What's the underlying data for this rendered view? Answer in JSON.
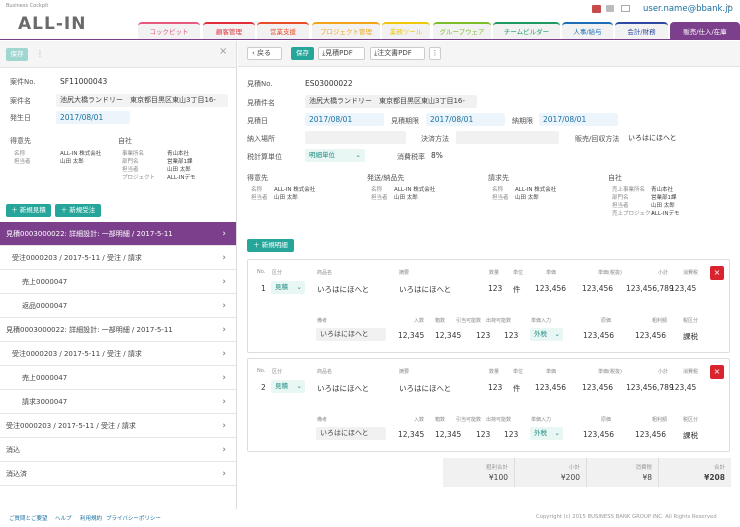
{
  "header": {
    "cockpit": "Business Cockpit",
    "logo": "ALL-IN",
    "user": "user.name@bbank.jp",
    "tabs": [
      {
        "label": "コックピット",
        "color": "#e85a7d"
      },
      {
        "label": "顧客管理",
        "color": "#e02f3a"
      },
      {
        "label": "営業支援",
        "color": "#e94c28"
      },
      {
        "label": "プロジェクト管理",
        "color": "#f2a51a"
      },
      {
        "label": "業務ツール",
        "color": "#eec70a"
      },
      {
        "label": "グループウェア",
        "color": "#7dbd2b"
      },
      {
        "label": "チームビルダー",
        "color": "#1f9a63"
      },
      {
        "label": "人事/給与",
        "color": "#1d6fb5"
      },
      {
        "label": "会計/財務",
        "color": "#2d4aa3"
      },
      {
        "label": "販売/仕入/在庫",
        "color": "#7b3f8c"
      }
    ]
  },
  "left": {
    "save": "保存",
    "menu": "⋮",
    "close": "×",
    "fields": [
      {
        "label": "案件No.",
        "value": "SF11000043"
      },
      {
        "label": "案件名",
        "value": "池尻大橋ランドリー　東京都目黒区東山3丁目16-"
      },
      {
        "label": "発生日",
        "value": "2017/08/01"
      }
    ],
    "tokui_title": "得意先",
    "tokui": [
      {
        "k": "名称",
        "v": "ALL-IN 株式会社"
      },
      {
        "k": "担当者",
        "v": "山田 太郎"
      }
    ],
    "jisha_title": "自社",
    "jisha": [
      {
        "k": "事業所名",
        "v": "青山本社"
      },
      {
        "k": "部門名",
        "v": "営業部1課"
      },
      {
        "k": "担当者",
        "v": "山田 太郎"
      },
      {
        "k": "プロジェクト",
        "v": "ALL-INデモ"
      }
    ],
    "new_estimate": "＋ 新規見積",
    "new_order": "＋ 新規受注",
    "list": [
      {
        "text": "見積0003000022: 詳細設計: 一部明細 / 2017-5-11",
        "level": 0,
        "active": true
      },
      {
        "text": "受注0000203 / 2017-5-11 / 受注 / 請求",
        "level": 1
      },
      {
        "text": "売上0000047",
        "level": 2
      },
      {
        "text": "返品0000047",
        "level": 2
      },
      {
        "text": "見積0003000022: 詳細設計: 一部明細 / 2017-5-11",
        "level": 0
      },
      {
        "text": "受注0000203 / 2017-5-11 / 受注 / 請求",
        "level": 1
      },
      {
        "text": "売上0000047",
        "level": 2
      },
      {
        "text": "請求3000047",
        "level": 2
      },
      {
        "text": "受注0000203 / 2017-5-11 / 受注 / 請求",
        "level": 0
      },
      {
        "text": "消込",
        "level": 0
      },
      {
        "text": "消込済",
        "level": 0
      }
    ]
  },
  "toolbar": {
    "back": "戻る",
    "save": "保存",
    "estimate_pdf": "見積PDF",
    "order_pdf": "注文書PDF",
    "menu": "⋮"
  },
  "form": {
    "estimate_no_label": "見積No.",
    "estimate_no": "ES03000022",
    "estimate_name_label": "見積件名",
    "estimate_name": "池尻大橋ランドリー　東京都目黒区東山3丁目16-",
    "estimate_date_label": "見積日",
    "estimate_date": "2017/08/01",
    "valid_label": "見積期限",
    "valid_date": "2017/08/01",
    "delivery_label": "納期限",
    "delivery_date": "2017/08/01",
    "place_label": "納入場所",
    "payment_label": "決済方法",
    "sales_label": "販売/回収方法",
    "sales_value": "いろはにほへと",
    "tax_unit_label": "税計算単位",
    "tax_unit": "明細単位",
    "tax_rate_label": "消費税率",
    "tax_rate": "8%"
  },
  "parties": [
    {
      "title": "得意先",
      "rows": [
        {
          "k": "名称",
          "v": "ALL-IN 株式会社"
        },
        {
          "k": "担当者",
          "v": "山田 太郎"
        }
      ]
    },
    {
      "title": "発送/納品先",
      "rows": [
        {
          "k": "名称",
          "v": "ALL-IN 株式会社"
        },
        {
          "k": "担当者",
          "v": "山田 太郎"
        }
      ]
    },
    {
      "title": "請求先",
      "rows": [
        {
          "k": "名称",
          "v": "ALL-IN 株式会社"
        },
        {
          "k": "担当者",
          "v": "山田 太郎"
        }
      ]
    },
    {
      "title": "自社",
      "rows": [
        {
          "k": "売上事業所名",
          "v": "青山本社"
        },
        {
          "k": "部門名",
          "v": "営業部1課"
        },
        {
          "k": "担当者",
          "v": "山田 太郎"
        },
        {
          "k": "売上プロジェクト",
          "v": "ALL-INデモ"
        }
      ]
    }
  ],
  "new_detail": "＋ 新規明細",
  "detail_headers": {
    "no": "No.",
    "kubun": "区分",
    "name": "商品名",
    "summary": "摘要",
    "qty": "数量",
    "unit": "単位",
    "price": "単価",
    "price_tax": "単価(税抜)",
    "subtotal": "小計",
    "tax": "消費税"
  },
  "detail_headers2": {
    "note": "備考",
    "in_qty": "入数",
    "boxes": "箱数",
    "deducted": "引当可能数",
    "shipped": "出荷可能数",
    "tax_input": "単価入力",
    "cost": "原価",
    "gross": "粗利額",
    "tax_type": "税区分"
  },
  "details": [
    {
      "no": "1",
      "kubun": "見積",
      "name": "いろはにほへと",
      "summary": "いろはにほへと",
      "qty": "123",
      "unit": "件",
      "price": "123,456",
      "price_tax": "123,456",
      "subtotal": "123,456,789",
      "tax": "123,45",
      "note": "いろはにほへと",
      "in_qty": "12,345",
      "boxes": "12,345",
      "deducted": "123",
      "shipped": "123",
      "tax_input": "外税",
      "cost": "123,456",
      "gross": "123,456",
      "tax_type": "課税"
    },
    {
      "no": "2",
      "kubun": "見積",
      "name": "いろはにほへと",
      "summary": "いろはにほへと",
      "qty": "123",
      "unit": "件",
      "price": "123,456",
      "price_tax": "123,456",
      "subtotal": "123,456,789",
      "tax": "123,45",
      "note": "いろはにほへと",
      "in_qty": "12,345",
      "boxes": "12,345",
      "deducted": "123",
      "shipped": "123",
      "tax_input": "外税",
      "cost": "123,456",
      "gross": "123,456",
      "tax_type": "課税"
    }
  ],
  "totals": [
    {
      "label": "粗利合計",
      "value": "¥100"
    },
    {
      "label": "小計",
      "value": "¥200"
    },
    {
      "label": "消費税",
      "value": "¥8"
    },
    {
      "label": "合計",
      "value": "¥208"
    }
  ],
  "footer": {
    "links": [
      "ご質問とご要望",
      "ヘルプ",
      "利用規約",
      "プライバシーポリシー"
    ],
    "copyright": "Copyright (c) 2015 BUSINESS BANK GROUP INC. All Rights Reserved"
  }
}
